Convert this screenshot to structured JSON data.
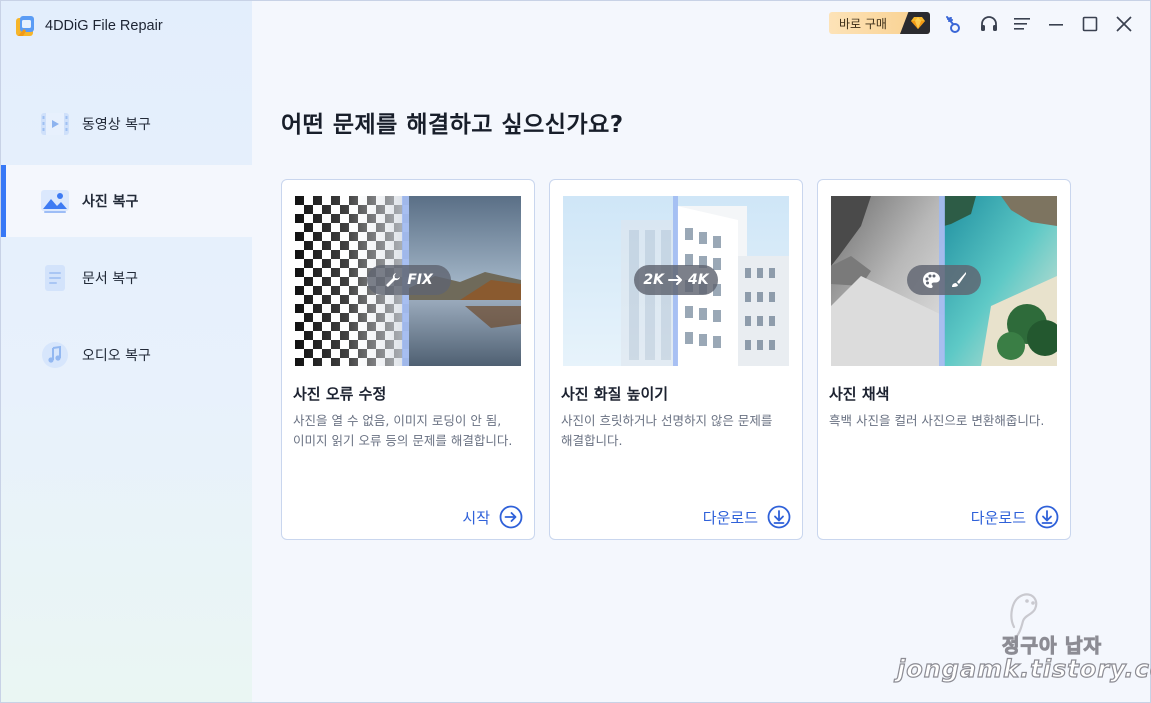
{
  "app": {
    "title": "4DDiG File Repair"
  },
  "colors": {
    "accent": "#3778f6",
    "action": "#2f61d9",
    "buy_badge": "#fbd79c"
  },
  "sidebar": {
    "items": [
      {
        "label": "동영상 복구",
        "icon": "video-film-icon",
        "active": false
      },
      {
        "label": "사진 복구",
        "icon": "photo-image-icon",
        "active": true
      },
      {
        "label": "문서 복구",
        "icon": "document-icon",
        "active": false
      },
      {
        "label": "오디오 복구",
        "icon": "music-note-icon",
        "active": false
      }
    ]
  },
  "topbar": {
    "buy_label": "바로 구매",
    "icons": [
      "diamond-icon",
      "key-icon",
      "headset-icon",
      "menu-icon",
      "minimize-icon",
      "maximize-icon",
      "close-icon"
    ]
  },
  "main": {
    "heading": "어떤 문제를 해결하고 싶으신가요?",
    "cards": [
      {
        "title": "사진 오류 수정",
        "description": "사진을 열 수 없음, 이미지 로딩이 안 됨, 이미지 읽기 오류 등의 문제를 해결합니다.",
        "badge": "FIX",
        "action_label": "시작",
        "action_icon": "arrow-right-circle-icon"
      },
      {
        "title": "사진 화질 높이기",
        "description": "사진이 흐릿하거나 선명하지 않은 문제를 해결합니다.",
        "badge_from": "2K",
        "badge_to": "4K",
        "action_label": "다운로드",
        "action_icon": "download-circle-icon"
      },
      {
        "title": "사진 채색",
        "description": "흑백 사진을 컬러 사진으로 변환해줍니다.",
        "action_label": "다운로드",
        "action_icon": "download-circle-icon"
      }
    ]
  },
  "watermark": {
    "line1": "정구아 납자",
    "line2": "jongamk.tistory.com"
  }
}
